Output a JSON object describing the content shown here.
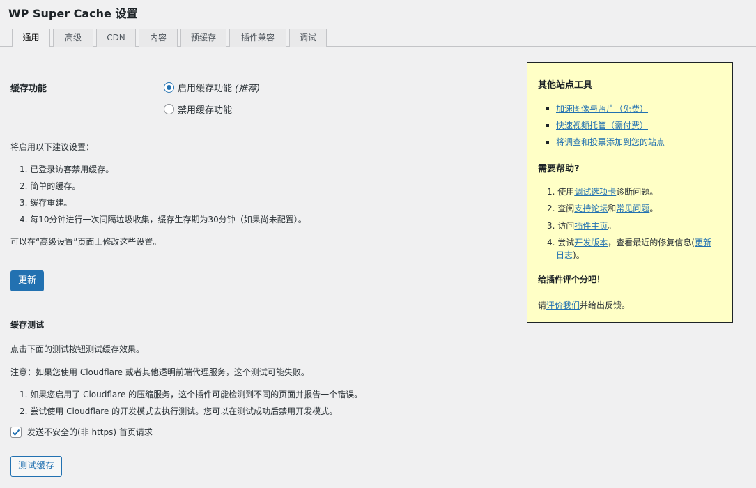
{
  "title": "WP Super Cache 设置",
  "tabs": [
    "通用",
    "高级",
    "CDN",
    "内容",
    "预缓存",
    "插件兼容",
    "调试"
  ],
  "caching": {
    "label": "缓存功能",
    "option_on": "启用缓存功能",
    "option_on_note": "(推荐)",
    "option_off": "禁用缓存功能",
    "selected": "on"
  },
  "recommended": {
    "intro": "将启用以下建议设置：",
    "items": [
      "1. 已登录访客禁用缓存。",
      "2. 简单的缓存。",
      "3. 缓存重建。",
      "4. 每10分钟进行一次间隔垃圾收集，缓存生存期为30分钟（如果尚未配置）。"
    ],
    "note": "可以在“高级设置”页面上修改这些设置。"
  },
  "update_button": "更新",
  "cache_test": {
    "heading": "缓存测试",
    "desc": "点击下面的测试按钮测试缓存效果。",
    "warning": "注意：如果您使用 Cloudflare 或者其他透明前端代理服务，这个测试可能失败。",
    "items": [
      "1. 如果您启用了 Cloudflare 的压缩服务，这个插件可能检测到不同的页面并报告一个错误。",
      "2. 尝试使用 Cloudflare 的开发模式去执行测试。您可以在测试成功后禁用开发模式。"
    ],
    "checkbox_label": "发送不安全的(非 https) 首页请求",
    "checkbox_checked": true,
    "test_button": "测试缓存"
  },
  "sidebar": {
    "tools_heading": "其他站点工具",
    "tools": [
      "加速图像与照片（免费）",
      "快速视频托管（需付费）",
      "将调查和投票添加到您的站点"
    ],
    "help_heading": "需要帮助?",
    "help": {
      "i1_pre": "1. 使用",
      "i1_link": "调试选项卡",
      "i1_post": "诊断问题。",
      "i2_pre": "2. 查阅",
      "i2_link1": "支持论坛",
      "i2_mid": "和",
      "i2_link2": "常见问题",
      "i2_post": "。",
      "i3_pre": "3. 访问",
      "i3_link": "插件主页",
      "i3_post": "。",
      "i4_pre": "4. 尝试",
      "i4_link": "开发版本",
      "i4_mid": "，查看最近的修复信息(",
      "i4_link2a": "更新",
      "i4_link2b": "日志",
      "i4_post": ")。"
    },
    "rate_heading": "给插件评个分吧！",
    "rate_pre": "请",
    "rate_link": "评价我们",
    "rate_post": "并给出反馈。"
  },
  "colors": {
    "primary": "#2271b1",
    "sidebox_bg": "#ffffc6",
    "page_bg": "#f0f0f1"
  }
}
